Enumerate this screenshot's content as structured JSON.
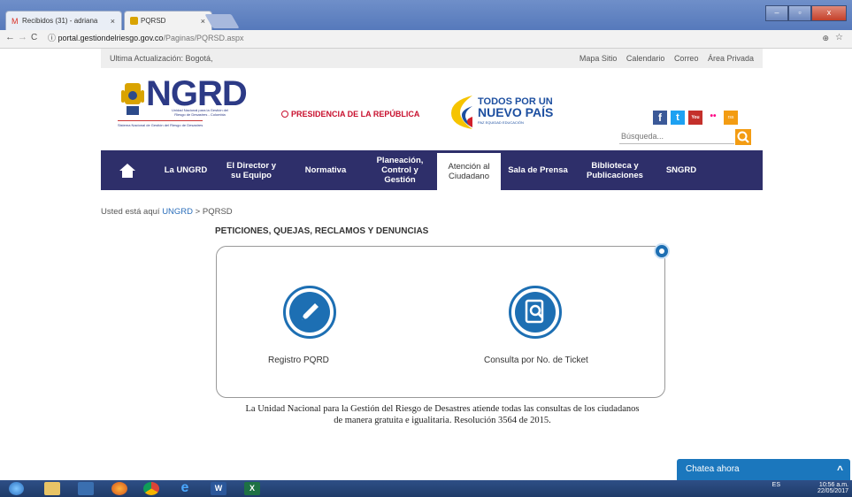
{
  "browser": {
    "tabs": [
      {
        "label": "Recibidos (31) - adriana",
        "close": "×"
      },
      {
        "label": "PQRSD",
        "close": "×"
      }
    ],
    "url_host": "portal.gestiondelriesgo.gov.co",
    "url_path": "/Paginas/PQRSD.aspx",
    "back": "←",
    "forward": "→",
    "reload": "C",
    "info": "ⓘ",
    "zoom_icon": "⊕",
    "star_icon": "☆"
  },
  "site": {
    "top_left": "Ultima Actualización: Bogotá,",
    "top_links": [
      "Mapa Sitio",
      "Calendario",
      "Correo",
      "Área Privada"
    ],
    "logo_text": "NGRD",
    "logo_sub1": "Unidad Nacional para la Gestión del",
    "logo_sub2": "Riesgo de Desastres - Colombia",
    "logo_sub3": "Sistema Nacional de Gestión del Riesgo de Desastres",
    "presidencia": "PRESIDENCIA DE LA REPÚBLICA",
    "todos1": "TODOS POR UN",
    "todos2": "NUEVO PAÍS",
    "todos3": "PAZ  EQUIDAD  EDUCACIÓN",
    "search_placeholder": "Búsqueda...",
    "social": [
      "f",
      "t",
      "You",
      "••",
      "rss"
    ]
  },
  "nav": [
    {
      "label": "La UNGRD"
    },
    {
      "label": "El Director y su Equipo"
    },
    {
      "label": "Normativa"
    },
    {
      "label": "Planeación, Control y Gestión"
    },
    {
      "label": "Atención al Ciudadano"
    },
    {
      "label": "Sala de Prensa"
    },
    {
      "label": "Biblioteca y Publicaciones"
    },
    {
      "label": "SNGRD"
    }
  ],
  "breadcrumb": {
    "prefix": "Usted está aquí",
    "link": "UNGRD",
    "sep": ">",
    "current": "PQRSD"
  },
  "page_title": "PETICIONES, QUEJAS, RECLAMOS Y DENUNCIAS",
  "options": [
    {
      "label": "Registro PQRD"
    },
    {
      "label": "Consulta por No. de Ticket"
    }
  ],
  "footer_line1": "La Unidad Nacional para la Gestión del Riesgo de Desastres atiende todas las consultas de los ciudadanos",
  "footer_line2": "de manera gratuita e igualitaria. Resolución 3564 de 2015.",
  "chat": {
    "label": "Chatea ahora",
    "toggle": "^"
  },
  "taskbar": {
    "lang": "ES",
    "time": "10:56 a.m.",
    "date": "22/05/2017"
  },
  "colors": {
    "nav_bg": "#2e2f6a",
    "accent_blue": "#1d6fb3",
    "search_orange": "#f39c12"
  }
}
